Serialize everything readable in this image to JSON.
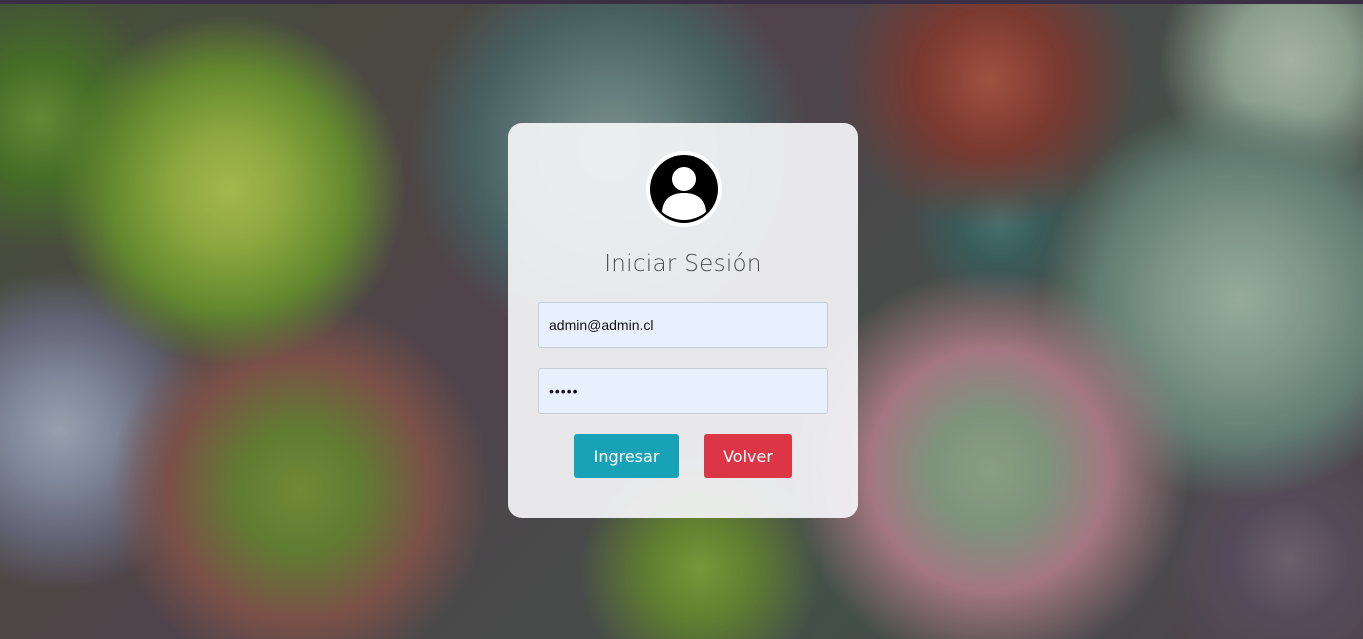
{
  "login": {
    "title": "Iniciar Sesión",
    "email_value": "admin@admin.cl",
    "password_value": "•••••",
    "submit_label": "Ingresar",
    "back_label": "Volver"
  },
  "colors": {
    "submit_button": "#17a2b8",
    "back_button": "#dc3545",
    "input_background": "#e8f0fe"
  },
  "icons": {
    "avatar": "user-avatar-icon"
  }
}
